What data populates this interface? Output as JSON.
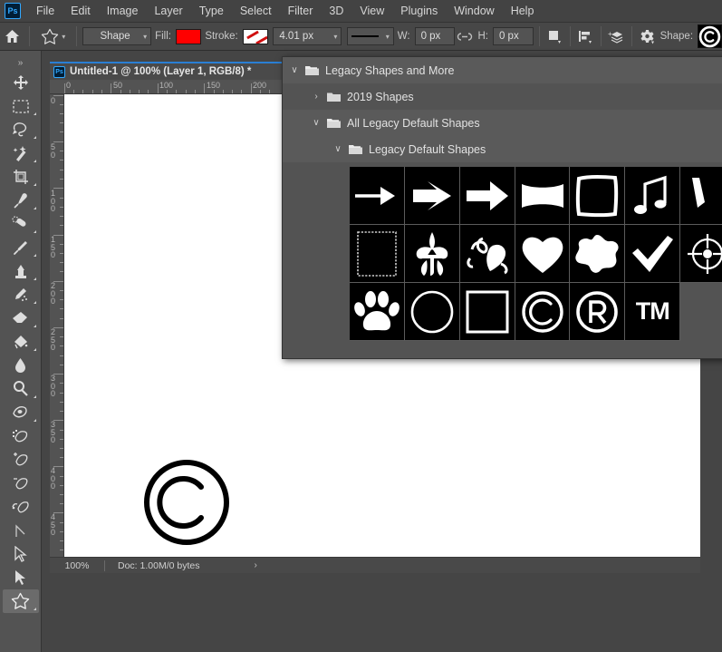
{
  "app": {
    "logo": "Ps"
  },
  "menubar": {
    "items": [
      {
        "label": "File"
      },
      {
        "label": "Edit"
      },
      {
        "label": "Image"
      },
      {
        "label": "Layer"
      },
      {
        "label": "Type"
      },
      {
        "label": "Select"
      },
      {
        "label": "Filter"
      },
      {
        "label": "3D"
      },
      {
        "label": "View"
      },
      {
        "label": "Plugins"
      },
      {
        "label": "Window"
      },
      {
        "label": "Help"
      }
    ]
  },
  "options_bar": {
    "home_icon": "home-icon",
    "tool_icon": "custom-shape-icon",
    "mode_value": "Shape",
    "fill_label": "Fill:",
    "fill_color": "#ff0000",
    "stroke_label": "Stroke:",
    "stroke_color": "#ffffff",
    "stroke_width": "4.01 px",
    "line_style": "solid-line",
    "w_label": "W:",
    "w_value": "0 px",
    "link_icon": "link-chain-icon",
    "h_label": "H:",
    "h_value": "0 px",
    "path_ops_icon": "path-operations-icon",
    "align_icon": "path-alignment-icon",
    "arrange_icon": "path-arrangement-icon",
    "settings_icon": "gear-icon",
    "shape_label": "Shape:",
    "shape_preview": "copyright-shape-thumbnail"
  },
  "toolbar": {
    "tools": [
      {
        "name": "move-tool",
        "icon": "move-icon",
        "has_submenu": false,
        "active": false
      },
      {
        "name": "rectangular-marquee-tool",
        "icon": "marquee-icon",
        "has_submenu": true,
        "active": false
      },
      {
        "name": "lasso-tool",
        "icon": "lasso-icon",
        "has_submenu": true,
        "active": false
      },
      {
        "name": "object-selection-tool",
        "icon": "magic-wand-icon",
        "has_submenu": true,
        "active": false
      },
      {
        "name": "crop-tool",
        "icon": "crop-icon",
        "has_submenu": true,
        "active": false
      },
      {
        "name": "eyedropper-tool",
        "icon": "eyedropper-icon",
        "has_submenu": true,
        "active": false
      },
      {
        "name": "spot-healing-brush-tool",
        "icon": "healing-brush-icon",
        "has_submenu": true,
        "active": false
      },
      {
        "name": "brush-tool",
        "icon": "brush-icon",
        "has_submenu": true,
        "active": false
      },
      {
        "name": "clone-stamp-tool",
        "icon": "stamp-icon",
        "has_submenu": true,
        "active": false
      },
      {
        "name": "history-brush-tool",
        "icon": "history-brush-icon",
        "has_submenu": true,
        "active": false
      },
      {
        "name": "eraser-tool",
        "icon": "eraser-icon",
        "has_submenu": true,
        "active": false
      },
      {
        "name": "gradient-tool",
        "icon": "paint-bucket-icon",
        "has_submenu": true,
        "active": false
      },
      {
        "name": "blur-tool",
        "icon": "blur-drop-icon",
        "has_submenu": false,
        "active": false
      },
      {
        "name": "dodge-tool",
        "icon": "dodge-icon",
        "has_submenu": true,
        "active": false
      },
      {
        "name": "pen-tool",
        "icon": "pen-icon",
        "has_submenu": true,
        "active": false
      },
      {
        "name": "freeform-pen-tool",
        "icon": "freeform-pen-icon",
        "has_submenu": false,
        "active": false
      },
      {
        "name": "add-anchor-point-tool",
        "icon": "add-anchor-icon",
        "has_submenu": false,
        "active": false
      },
      {
        "name": "delete-anchor-point-tool",
        "icon": "delete-anchor-icon",
        "has_submenu": false,
        "active": false
      },
      {
        "name": "convert-point-tool",
        "icon": "convert-point-icon",
        "has_submenu": false,
        "active": false
      },
      {
        "name": "path-line-tool",
        "icon": "line-segment-icon",
        "has_submenu": false,
        "active": false
      },
      {
        "name": "path-selection-tool",
        "icon": "path-arrow-icon",
        "has_submenu": false,
        "active": false
      },
      {
        "name": "direct-selection-tool",
        "icon": "direct-select-arrow-icon",
        "has_submenu": false,
        "active": false
      },
      {
        "name": "custom-shape-tool",
        "icon": "custom-shape-icon",
        "has_submenu": true,
        "active": true
      }
    ]
  },
  "document": {
    "tab_title": "Untitled-1 @ 100% (Layer 1, RGB/8) *",
    "tab_icon": "Ps",
    "ruler_h_labels": [
      "0",
      "50",
      "100",
      "150",
      "200"
    ],
    "ruler_v_labels": [
      "0",
      "50",
      "100",
      "150",
      "200",
      "250",
      "300",
      "350",
      "400",
      "450"
    ],
    "canvas_shape": "copyright-symbol",
    "canvas_shape_color": "#000000"
  },
  "statusbar": {
    "zoom": "100%",
    "doc_info": "Doc: 1.00M/0 bytes",
    "expand_icon": "chevron-right-icon"
  },
  "shapes_panel": {
    "tree": [
      {
        "label": "Legacy Shapes and More",
        "level": 1,
        "expanded": true,
        "twisty": "∨"
      },
      {
        "label": "2019 Shapes",
        "level": 2,
        "expanded": false,
        "twisty": "›"
      },
      {
        "label": "All Legacy Default Shapes",
        "level": 3,
        "expanded": true,
        "twisty": "∨"
      },
      {
        "label": "Legacy Default Shapes",
        "level": 4,
        "expanded": true,
        "twisty": "∨"
      }
    ],
    "grid": [
      [
        {
          "name": "thin-arrow-shape"
        },
        {
          "name": "chevron-arrow-shape"
        },
        {
          "name": "solid-arrow-shape"
        },
        {
          "name": "concave-rectangle-shape"
        },
        {
          "name": "square-frame-shape"
        },
        {
          "name": "music-note-shape"
        },
        {
          "name": "ribbon-shape"
        }
      ],
      [
        {
          "name": "postage-stamp-shape"
        },
        {
          "name": "fleur-de-lis-shape"
        },
        {
          "name": "ornament-heart-shape"
        },
        {
          "name": "heart-shape"
        },
        {
          "name": "splat-blob-shape"
        },
        {
          "name": "checkmark-shape"
        },
        {
          "name": "crosshair-target-shape"
        }
      ],
      [
        {
          "name": "paw-print-shape"
        },
        {
          "name": "circle-outline-shape"
        },
        {
          "name": "square-outline-shape"
        },
        {
          "name": "copyright-shape"
        },
        {
          "name": "registered-trademark-shape"
        },
        {
          "name": "trademark-shape"
        },
        {
          "name": "blank-shape"
        }
      ]
    ]
  }
}
